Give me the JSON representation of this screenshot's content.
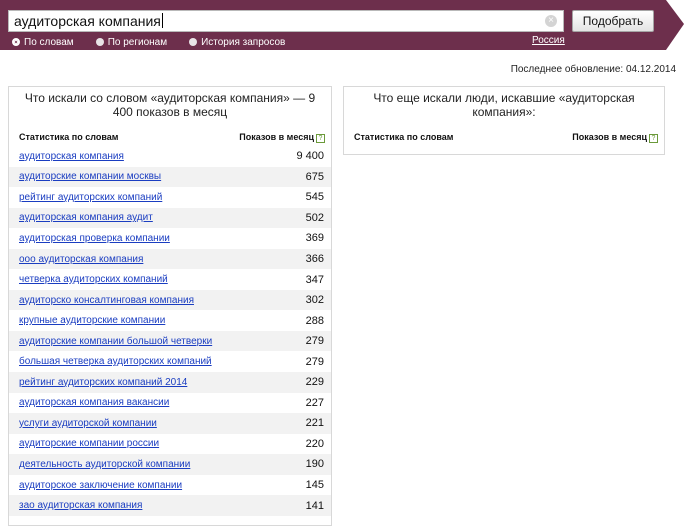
{
  "search": {
    "query": "аудиторская компания",
    "submit_label": "Подобрать",
    "clear_glyph": "×"
  },
  "modes": [
    {
      "label": "По словам",
      "selected": true
    },
    {
      "label": "По регионам",
      "selected": false
    },
    {
      "label": "История запросов",
      "selected": false
    }
  ],
  "region": "Россия",
  "updated": "Последнее обновление: 04.12.2014",
  "left_panel": {
    "title": "Что искали со словом «аудиторская компания» — 9 400 показов в месяц",
    "col_phrase": "Статистика по словам",
    "col_count": "Показов в месяц",
    "help": "?",
    "rows": [
      {
        "phrase": "аудиторская компания",
        "count": "9 400"
      },
      {
        "phrase": "аудиторские компании москвы",
        "count": "675"
      },
      {
        "phrase": "рейтинг аудиторских компаний",
        "count": "545"
      },
      {
        "phrase": "аудиторская компания аудит",
        "count": "502"
      },
      {
        "phrase": "аудиторская проверка компании",
        "count": "369"
      },
      {
        "phrase": "ооо аудиторская компания",
        "count": "366"
      },
      {
        "phrase": "четверка аудиторских компаний",
        "count": "347"
      },
      {
        "phrase": "аудиторско консалтинговая компания",
        "count": "302"
      },
      {
        "phrase": "крупные аудиторские компании",
        "count": "288"
      },
      {
        "phrase": "аудиторские компании большой четверки",
        "count": "279"
      },
      {
        "phrase": "большая четверка аудиторских компаний",
        "count": "279"
      },
      {
        "phrase": "рейтинг аудиторских компаний 2014",
        "count": "229"
      },
      {
        "phrase": "аудиторская компания вакансии",
        "count": "227"
      },
      {
        "phrase": "услуги аудиторской компании",
        "count": "221"
      },
      {
        "phrase": "аудиторские компании россии",
        "count": "220"
      },
      {
        "phrase": "деятельность аудиторской компании",
        "count": "190"
      },
      {
        "phrase": "аудиторское заключение компании",
        "count": "145"
      },
      {
        "phrase": "зао аудиторская компания",
        "count": "141"
      }
    ]
  },
  "right_panel": {
    "title": "Что еще искали люди, искавшие «аудиторская компания»:",
    "col_phrase": "Статистика по словам",
    "col_count": "Показов в месяц",
    "help": "?"
  },
  "colors": {
    "header_bg": "#6d2f4c",
    "link": "#1a3dc1",
    "row_alt": "#f2f2f2"
  }
}
